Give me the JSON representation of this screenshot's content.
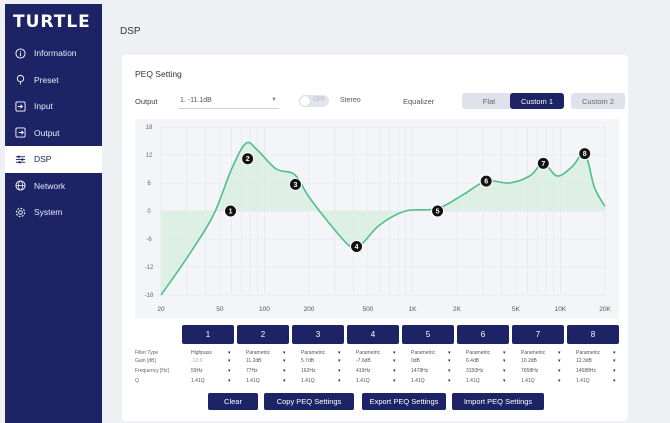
{
  "brand": "TURTLE",
  "sidebar": {
    "items": [
      {
        "label": "Information",
        "icon": "info-icon"
      },
      {
        "label": "Preset",
        "icon": "pin-icon"
      },
      {
        "label": "Input",
        "icon": "input-icon"
      },
      {
        "label": "Output",
        "icon": "output-icon"
      },
      {
        "label": "DSP",
        "icon": "sliders-icon",
        "active": true
      },
      {
        "label": "Network",
        "icon": "globe-icon"
      },
      {
        "label": "System",
        "icon": "gear-icon"
      }
    ]
  },
  "page": {
    "title": "DSP",
    "section_title": "PEQ Setting",
    "output_label": "Output",
    "output_value": "1. -11.1dB",
    "toggle_text": "OFF",
    "stereo_label": "Stereo",
    "equalizer_label": "Equalizer",
    "eq_buttons": [
      "Flat",
      "Custom 1",
      "Custom 2"
    ],
    "eq_active": "Custom 1"
  },
  "chart_data": {
    "type": "line",
    "x_scale": "log",
    "x_ticks": [
      "20",
      "50",
      "100",
      "200",
      "500",
      "1K",
      "2K",
      "5K",
      "10K",
      "20K"
    ],
    "y_ticks": [
      "18",
      "12",
      "6",
      "0",
      "-6",
      "-12",
      "-18"
    ],
    "ylim": [
      -18,
      18
    ],
    "xlim": [
      20,
      20000
    ],
    "grid": true,
    "series": [
      {
        "x": [
          20,
          30,
          45,
          60,
          75,
          90,
          120,
          160,
          200,
          280,
          380,
          450,
          600,
          900,
          1470,
          2200,
          3150,
          4500,
          6200,
          7658,
          9500,
          12000,
          14588,
          17000,
          20000
        ],
        "y": [
          -18,
          -10,
          -1,
          9,
          14.5,
          13,
          9,
          7.8,
          3,
          -3,
          -7.6,
          -7.2,
          -3,
          0,
          0.5,
          3.5,
          6.4,
          6.0,
          7.5,
          10.2,
          7.5,
          9.5,
          12.3,
          5,
          1
        ]
      }
    ],
    "points": [
      {
        "id": "1",
        "x": 59,
        "y": 0
      },
      {
        "id": "2",
        "x": 77,
        "y": 11.2
      },
      {
        "id": "3",
        "x": 162,
        "y": 5.7
      },
      {
        "id": "4",
        "x": 419,
        "y": -7.6
      },
      {
        "id": "5",
        "x": 1478,
        "y": 0
      },
      {
        "id": "6",
        "x": 3150,
        "y": 6.4
      },
      {
        "id": "7",
        "x": 7658,
        "y": 10.2
      },
      {
        "id": "8",
        "x": 14588,
        "y": 12.3
      }
    ]
  },
  "filters": {
    "row_labels": [
      "Filter Type",
      "Gain [dB]",
      "Frequency [Hz]",
      "Q"
    ],
    "bands": [
      {
        "num": "1",
        "type": "Highpass",
        "gain": "-12.0",
        "freq": "59Hz",
        "q": "1.41Q"
      },
      {
        "num": "2",
        "type": "Parametric",
        "gain": "11.2dB",
        "freq": "77Hz",
        "q": "1.41Q"
      },
      {
        "num": "3",
        "type": "Parametric",
        "gain": "5.7dB",
        "freq": "162Hz",
        "q": "1.41Q"
      },
      {
        "num": "4",
        "type": "Parametric",
        "gain": "-7.6dB",
        "freq": "419Hz",
        "q": "1.41Q"
      },
      {
        "num": "5",
        "type": "Parametric",
        "gain": "0dB",
        "freq": "1478Hz",
        "q": "1.41Q"
      },
      {
        "num": "6",
        "type": "Parametric",
        "gain": "6.4dB",
        "freq": "3150Hz",
        "q": "1.41Q"
      },
      {
        "num": "7",
        "type": "Parametric",
        "gain": "10.2dB",
        "freq": "7658Hz",
        "q": "1.41Q"
      },
      {
        "num": "8",
        "type": "Parametric",
        "gain": "12.3dB",
        "freq": "14588Hz",
        "q": "1.41Q"
      }
    ]
  },
  "actions": [
    "Clear",
    "Copy PEQ Settings",
    "Export PEQ Settings",
    "Import PEQ Settings"
  ],
  "colors": {
    "navy": "#1c2466",
    "curve": "#4fbf8a",
    "fill": "#d9efe2",
    "grid": "#e1e3e8"
  }
}
